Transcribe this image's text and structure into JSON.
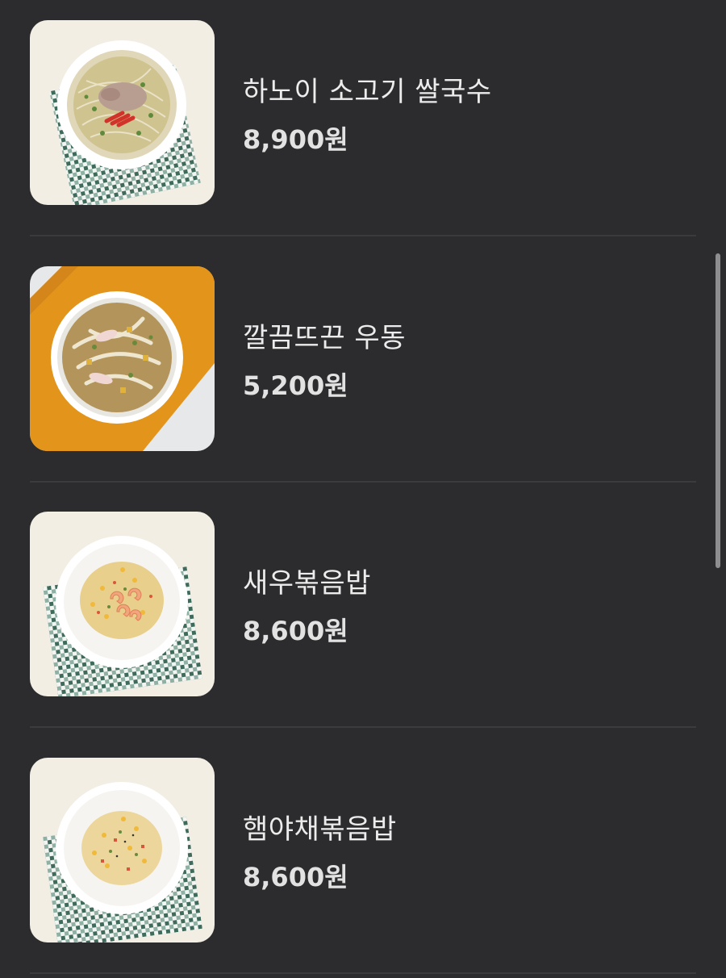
{
  "menu": {
    "items": [
      {
        "name": "하노이 소고기 쌀국수",
        "price": "8,900원",
        "image": "beef-pho-bowl"
      },
      {
        "name": "깔끔뜨끈 우동",
        "price": "5,200원",
        "image": "udon-bowl"
      },
      {
        "name": "새우볶음밥",
        "price": "8,600원",
        "image": "shrimp-fried-rice-plate"
      },
      {
        "name": "햄야채볶음밥",
        "price": "8,600원",
        "image": "ham-vegetable-fried-rice-plate"
      }
    ]
  },
  "colors": {
    "background": "#2c2c2e",
    "text": "#ececec",
    "divider": "#3b3b3e",
    "scrollbar": "#8e8e90"
  }
}
